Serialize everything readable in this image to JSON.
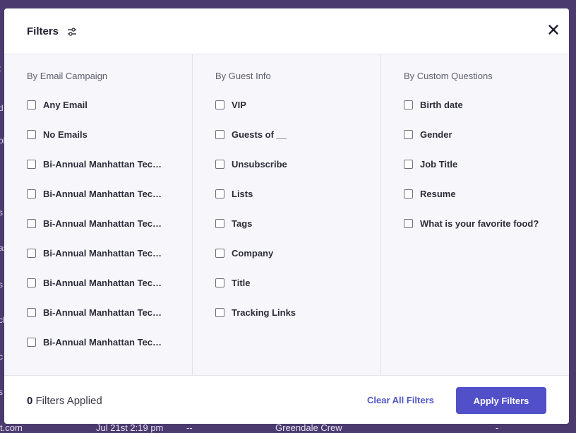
{
  "background": {
    "left_fragments": [
      "t",
      "d",
      "ol",
      "s",
      "as",
      "s",
      "ch",
      "c",
      "s"
    ],
    "bottom_row": {
      "email": "t.com",
      "date": "Jul 21st 2:19 pm",
      "dash1": "--",
      "group": "Greendale Crew",
      "dash2": "-"
    }
  },
  "modal": {
    "title": "Filters",
    "close_icon": "close-icon",
    "columns": [
      {
        "title": "By Email Campaign",
        "options": [
          "Any Email",
          "No Emails",
          "Bi-Annual Manhattan Tech...",
          "Bi-Annual Manhattan Tech...",
          "Bi-Annual Manhattan Tech...",
          "Bi-Annual Manhattan Tech...",
          "Bi-Annual Manhattan Tech...",
          "Bi-Annual Manhattan Tech...",
          "Bi-Annual Manhattan Tech..."
        ]
      },
      {
        "title": "By Guest Info",
        "options": [
          "VIP",
          "Guests of __",
          "Unsubscribe",
          "Lists",
          "Tags",
          "Company",
          "Title",
          "Tracking Links"
        ]
      },
      {
        "title": "By Custom Questions",
        "options": [
          "Birth date",
          "Gender",
          "Job Title",
          "Resume",
          "What is your favorite food?"
        ]
      }
    ],
    "footer": {
      "applied_count": "0",
      "applied_label": "Filters Applied",
      "clear_label": "Clear All Filters",
      "apply_label": "Apply Filters"
    }
  },
  "colors": {
    "overlay": "#4a3a6e",
    "accent": "#5150c9",
    "link": "#4f55c8",
    "body_bg": "#f7f7fb"
  }
}
